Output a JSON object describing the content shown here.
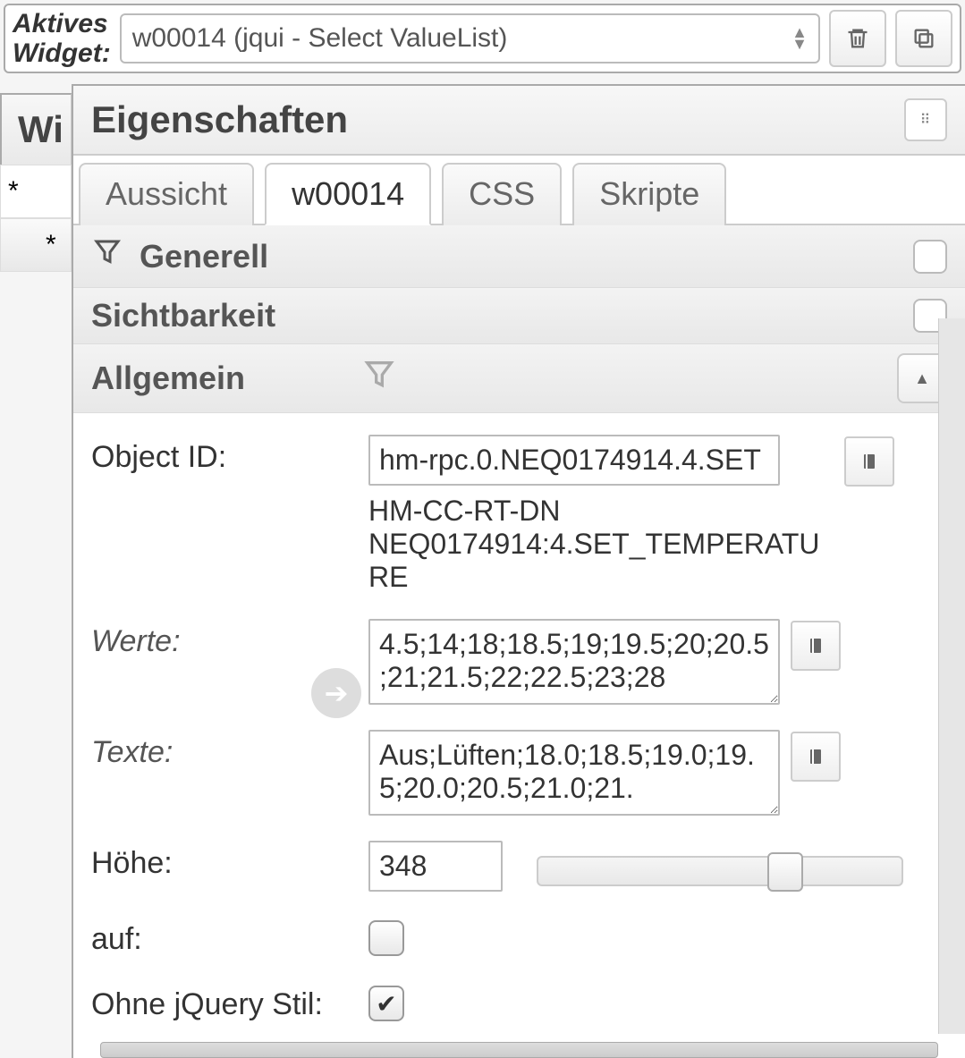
{
  "toolbar": {
    "label_line1": "Aktives",
    "label_line2": "Widget:",
    "selected_widget": "w00014 (jqui - Select ValueList)"
  },
  "left": {
    "heading": "Wi",
    "star1": "*",
    "star2": "*"
  },
  "panel": {
    "title": "Eigenschaften",
    "tabs": {
      "view": "Aussicht",
      "widget": "w00014",
      "css": "CSS",
      "scripts": "Skripte"
    }
  },
  "sections": {
    "generell": "Generell",
    "sichtbarkeit": "Sichtbarkeit",
    "allgemein": "Allgemein"
  },
  "props": {
    "object_id_label": "Object ID:",
    "object_id_value": "hm-rpc.0.NEQ0174914.4.SET",
    "object_desc": "HM-CC-RT-DN NEQ0174914:4.SET_TEMPERATURE",
    "werte_label": "Werte:",
    "werte_value": "4.5;14;18;18.5;19;19.5;20;20.5;21;21.5;22;22.5;23;28",
    "texte_label": "Texte:",
    "texte_value": "Aus;Lüften;18.0;18.5;19.0;19.5;20.0;20.5;21.0;21.",
    "hoehe_label": "Höhe:",
    "hoehe_value": "348",
    "auf_label": "auf:",
    "ohne_jquery_label": "Ohne jQuery Stil:",
    "ohne_jquery_checked": true
  }
}
